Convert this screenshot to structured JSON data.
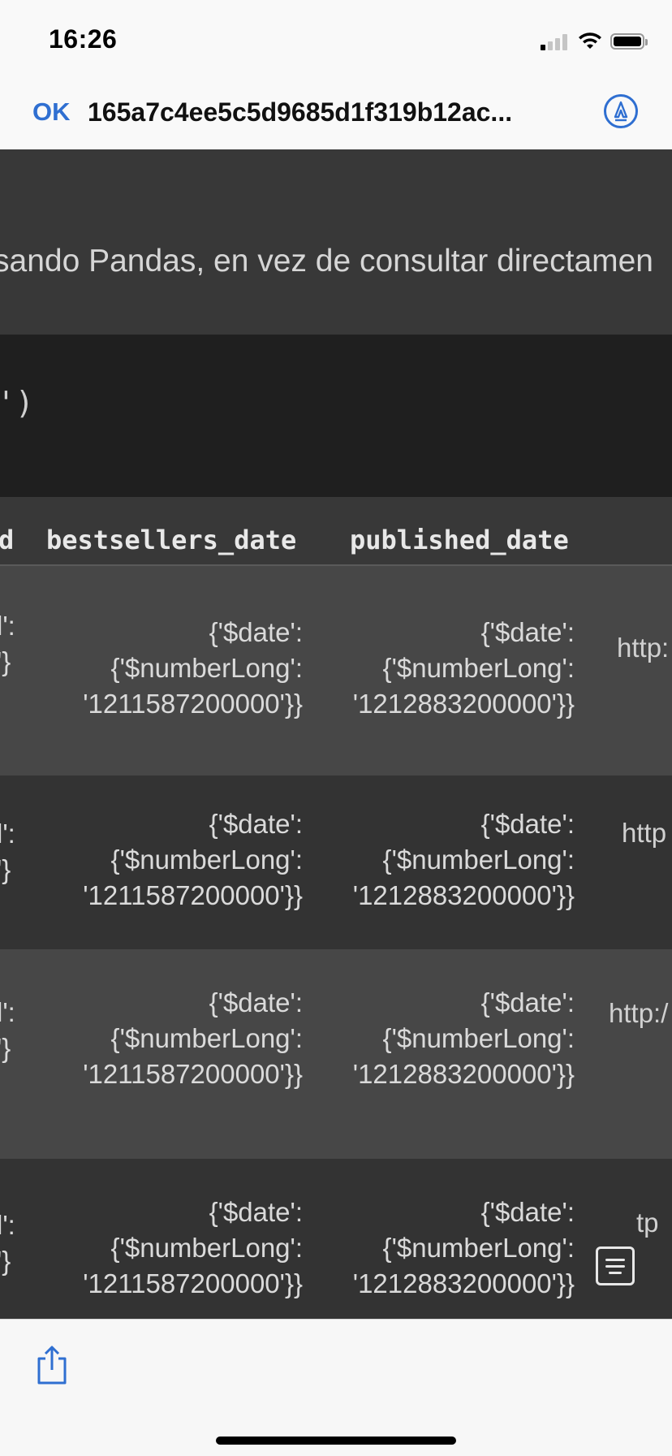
{
  "status": {
    "time": "16:26"
  },
  "nav": {
    "ok_label": "OK",
    "title": "165a7c4ee5c5d9685d1f319b12ac..."
  },
  "notebook": {
    "markdown_text": "sando Pandas, en vez de consultar directamen",
    "code_text": "')",
    "columns": [
      "d",
      "bestsellers_date",
      "published_date"
    ],
    "rows": [
      {
        "prev_a": "l':",
        "prev_b": "'}",
        "bestsellers_date": [
          "{'$date':",
          "{'$numberLong':",
          "'1211587200000'}}"
        ],
        "published_date": [
          "{'$date':",
          "{'$numberLong':",
          "'1212883200000'}}"
        ],
        "next": "http:"
      },
      {
        "prev_a": "l':",
        "prev_b": "'}",
        "bestsellers_date": [
          "{'$date':",
          "{'$numberLong':",
          "'1211587200000'}}"
        ],
        "published_date": [
          "{'$date':",
          "{'$numberLong':",
          "'1212883200000'}}"
        ],
        "next": "http"
      },
      {
        "prev_a": "l':",
        "prev_b": "'}",
        "bestsellers_date": [
          "{'$date':",
          "{'$numberLong':",
          "'1211587200000'}}"
        ],
        "published_date": [
          "{'$date':",
          "{'$numberLong':",
          "'1212883200000'}}"
        ],
        "next": "http:/"
      },
      {
        "prev_a": "l':",
        "prev_b": "'}",
        "bestsellers_date": [
          "{'$date':",
          "{'$numberLong':",
          "'1211587200000'}}"
        ],
        "published_date": [
          "{'$date':",
          "{'$numberLong':",
          "'1212883200000'}}"
        ],
        "next": "tp"
      }
    ]
  },
  "colors": {
    "accent": "#2f6fd1",
    "notebook_bg": "#333333",
    "code_bg": "#1f1f1f"
  },
  "icons": {
    "markup": "markup-pen-icon",
    "share": "share-icon",
    "live_text": "live-text-icon"
  }
}
